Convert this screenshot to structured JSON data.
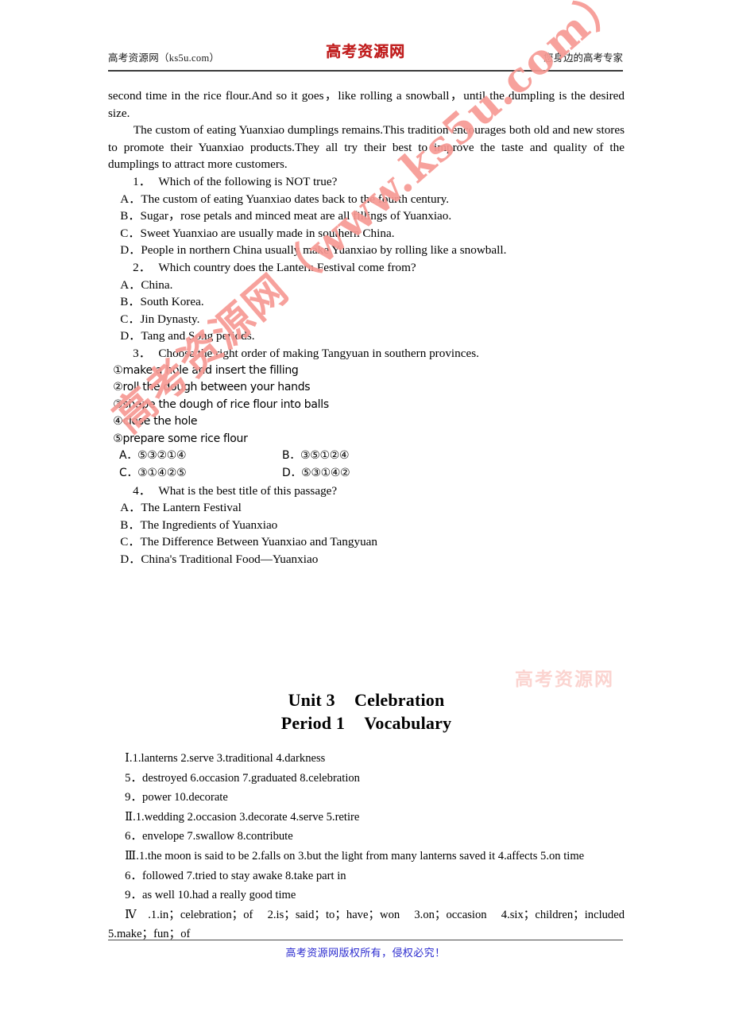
{
  "header": {
    "left_text": "高考资源网（ks5u.com）",
    "logo_text": "高考资源网",
    "right_text": "您身边的高考专家",
    "logo_color": "#c32020"
  },
  "passage": {
    "continuation": "second time in the rice flour.And so it goes，like rolling a snowball，until the dumpling is the desired size.",
    "paragraph_2": "The custom of eating Yuanxiao dumplings remains.This tradition encourages both old and new stores to promote their Yuanxiao products.They all try their best to improve the taste and quality of the dumplings to attract more customers."
  },
  "questions": [
    {
      "number": "1．",
      "stem": "Which of the following is NOT true?",
      "options": [
        "A．The custom of eating Yuanxiao dates back to the fourth century.",
        "B．Sugar，rose petals and minced meat are all fillings of Yuanxiao.",
        "C．Sweet Yuanxiao are usually made in southern China.",
        "D．People in northern China usually make Yuanxiao by rolling like a snowball."
      ]
    },
    {
      "number": "2．",
      "stem": "Which country does the Lantern Festival come from?",
      "options": [
        "A．China.",
        "B．South Korea.",
        "C．Jin Dynasty.",
        "D．Tang and Song periods."
      ]
    },
    {
      "number": "3．",
      "stem": "Choose the right order of making Tangyuan in southern provinces.",
      "steps": [
        "①make a hole and insert the filling",
        "②roll the dough between your hands",
        "③shape the dough of rice flour into balls",
        "④close the hole",
        "⑤prepare some rice flour"
      ],
      "option_grid": [
        {
          "left": "A．⑤③②①④",
          "right": "B．③⑤①②④"
        },
        {
          "left": "C．③①④②⑤",
          "right": "D．⑤③①④②"
        }
      ]
    },
    {
      "number": "4．",
      "stem": "What is the best title of this passage?",
      "options": [
        "A．The Lantern Festival",
        "B．The Ingredients of Yuanxiao",
        "C．The Difference Between Yuanxiao and Tangyuan",
        "D．China's Traditional Food—Yuanxiao"
      ]
    }
  ],
  "unit_heading": {
    "line1_left": "Unit 3",
    "line1_right": "Celebration",
    "line2_left": "Period 1",
    "line2_right": "Vocabulary"
  },
  "answer_key": {
    "sections": [
      {
        "numeral": "Ⅰ",
        "lines": [
          "Ⅰ.1.lanterns   2.serve   3.traditional   4.darkness",
          "5．destroyed   6.occasion   7.graduated   8.celebration",
          "9．power   10.decorate"
        ]
      },
      {
        "numeral": "Ⅱ",
        "lines": [
          "Ⅱ.1.wedding   2.occasion   3.decorate   4.serve   5.retire",
          "6．envelope   7.swallow   8.contribute"
        ]
      },
      {
        "numeral": "Ⅲ",
        "lines": [
          "Ⅲ.1.the moon is said to be   2.falls on   3.but the light from many lanterns saved it 4.affects   5.on time",
          "6．followed   7.tried to stay awake   8.take part in",
          "9．as well   10.had a really good time"
        ]
      },
      {
        "numeral": "Ⅳ",
        "lines": [
          "Ⅳ.1.in；celebration；of   2.is；said；to；have；won   3.on；occasion   4.six；children；included   5.make；fun；of"
        ]
      }
    ]
  },
  "footer": {
    "text": "高考资源网版权所有，侵权必究！",
    "color": "#2b2bcf"
  },
  "watermarks": {
    "diagonal": "高考资源网（www.ks5u.com）",
    "faint": "高考资源网",
    "diagonal_color": "#f79a94"
  }
}
